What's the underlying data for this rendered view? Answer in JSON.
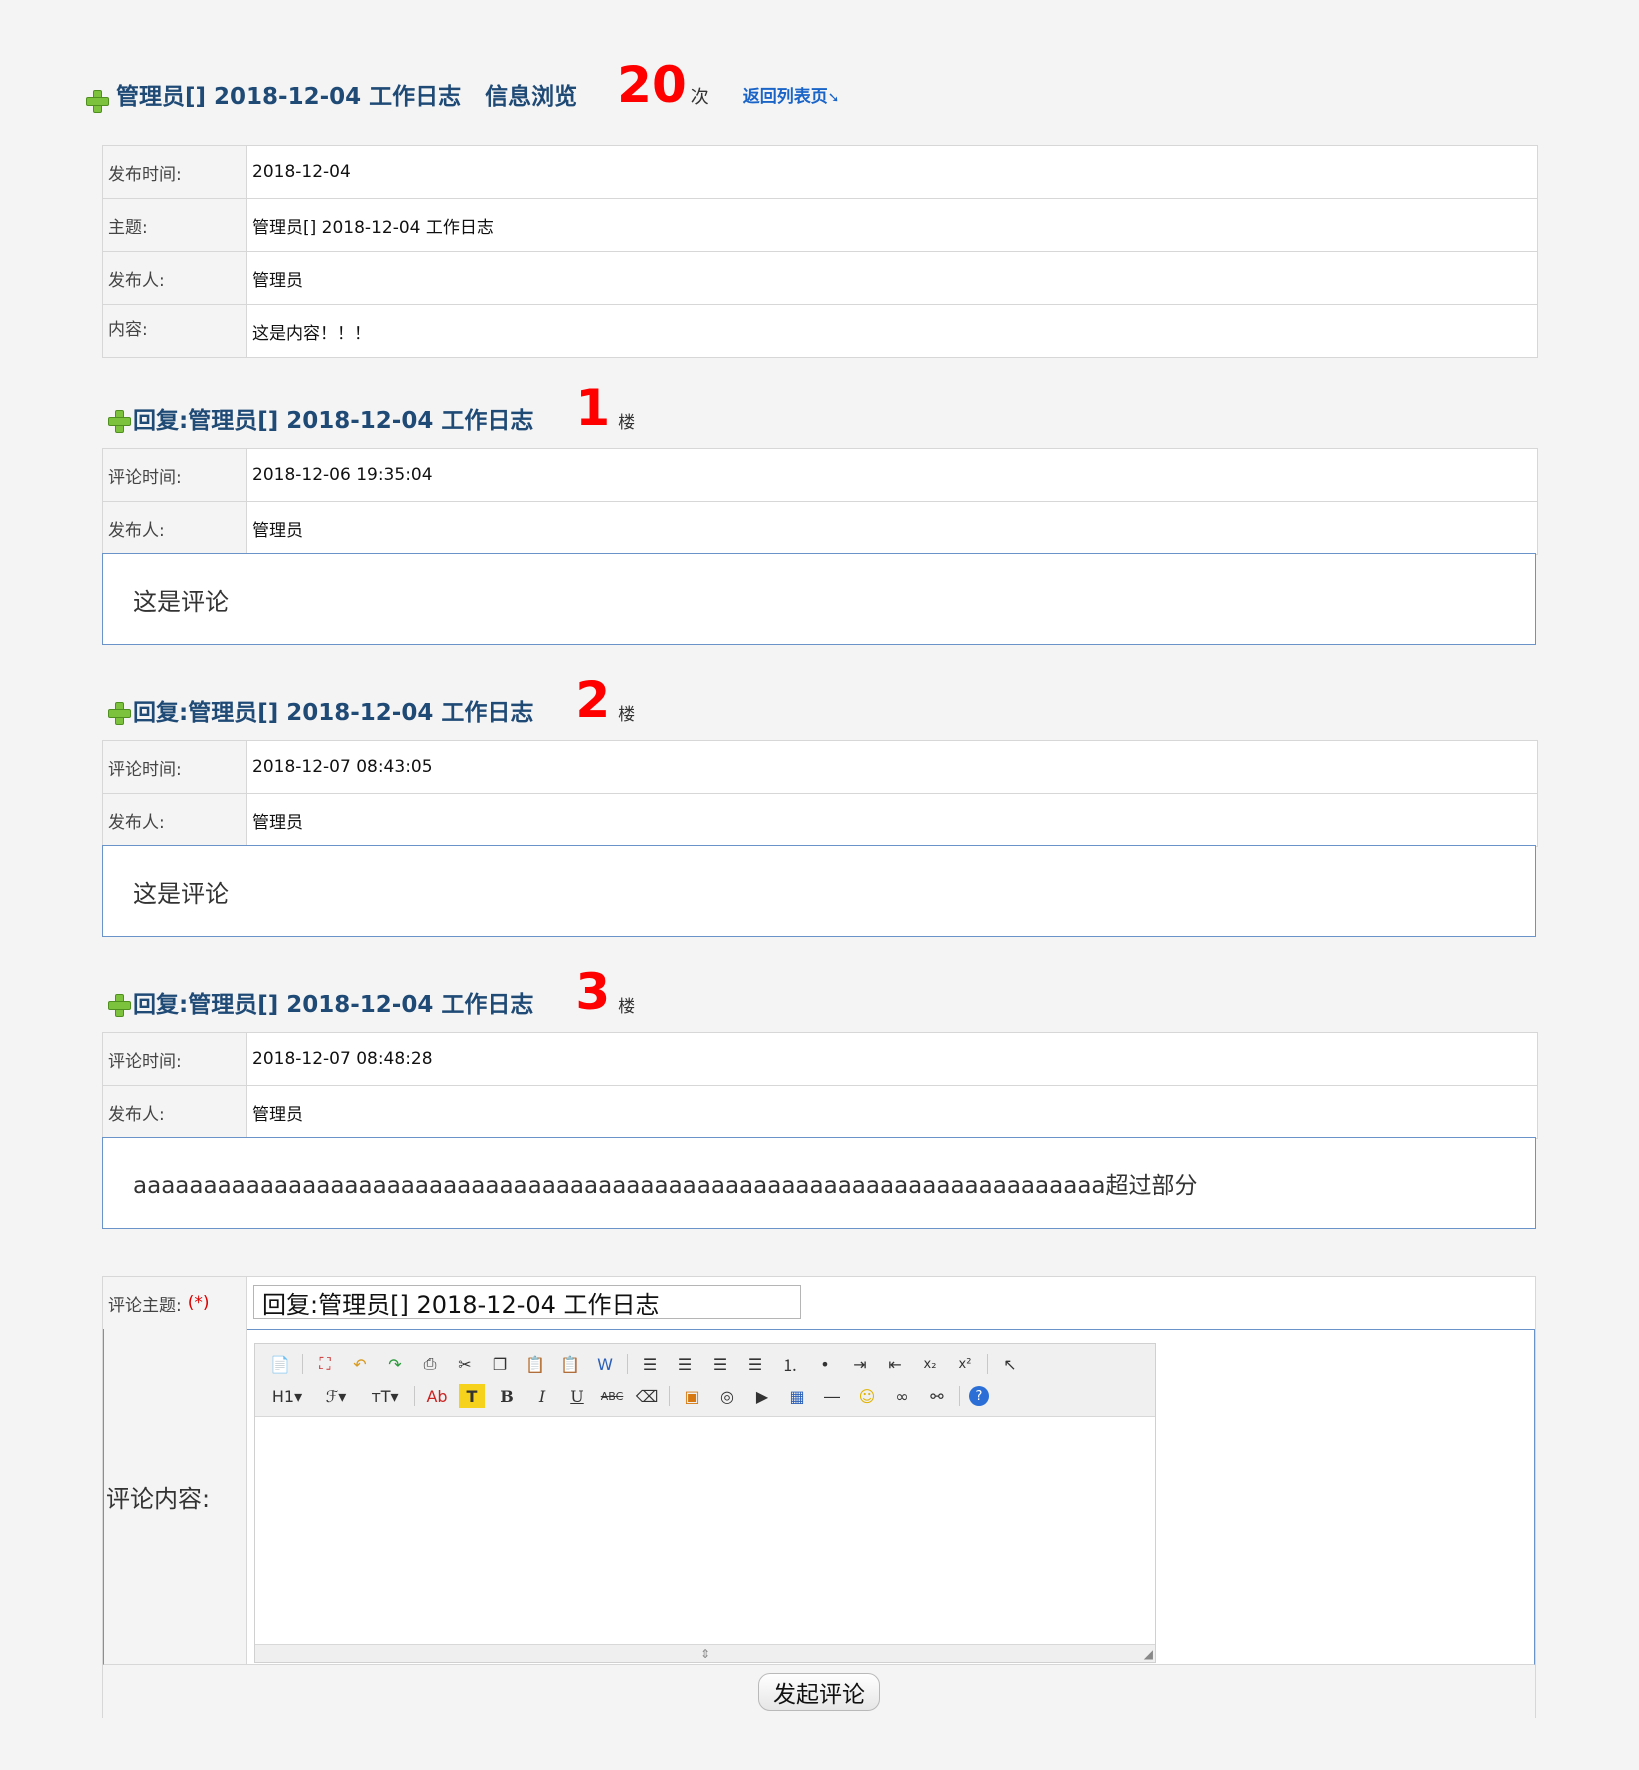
{
  "header": {
    "title": "管理员[] 2018-12-04 工作日志",
    "subtitle": "信息浏览",
    "view_count": "20",
    "view_unit": "次",
    "back_link": "返回列表页",
    "back_icon": "arrow-down-right-icon"
  },
  "post": {
    "rows": [
      {
        "label": "发布时间:",
        "value": "2018-12-04"
      },
      {
        "label": "主题:",
        "value": "管理员[] 2018-12-04 工作日志"
      },
      {
        "label": "发布人:",
        "value": "管理员"
      },
      {
        "label": "内容:",
        "value": "这是内容！！！"
      }
    ]
  },
  "replies": [
    {
      "title": "回复:管理员[] 2018-12-04 工作日志",
      "floor": "1",
      "floor_unit": "楼",
      "time_label": "评论时间:",
      "time": "2018-12-06 19:35:04",
      "author_label": "发布人:",
      "author": "管理员",
      "content": "这是评论"
    },
    {
      "title": "回复:管理员[] 2018-12-04 工作日志",
      "floor": "2",
      "floor_unit": "楼",
      "time_label": "评论时间:",
      "time": "2018-12-07 08:43:05",
      "author_label": "发布人:",
      "author": "管理员",
      "content": "这是评论"
    },
    {
      "title": "回复:管理员[] 2018-12-04 工作日志",
      "floor": "3",
      "floor_unit": "楼",
      "time_label": "评论时间:",
      "time": "2018-12-07 08:48:28",
      "author_label": "发布人:",
      "author": "管理员",
      "content": "aaaaaaaaaaaaaaaaaaaaaaaaaaaaaaaaaaaaaaaaaaaaaaaaaaaaaaaaaaaaaaaaaaaaa超过部分"
    }
  ],
  "form": {
    "subject_label": "评论主题:",
    "required_mark": "(*)",
    "subject_value": "回复:管理员[] 2018-12-04 工作日志",
    "content_label": "评论内容:",
    "submit_label": "发起评论"
  },
  "toolbar": {
    "row1": [
      "source-icon",
      "fullscreen-icon",
      "undo-icon",
      "redo-icon",
      "print-icon",
      "cut-icon",
      "copy-icon",
      "paste-icon",
      "paste-text-icon",
      "paste-word-icon",
      "align-left-icon",
      "align-center-icon",
      "align-right-icon",
      "justify-icon",
      "ordered-list-icon",
      "unordered-list-icon",
      "indent-icon",
      "outdent-icon",
      "subscript-icon",
      "superscript-icon",
      "select-all-icon"
    ],
    "row2": [
      "heading-icon",
      "font-family-icon",
      "font-size-icon",
      "font-color-icon",
      "highlight-icon",
      "bold-icon",
      "italic-icon",
      "underline-icon",
      "strikethrough-icon",
      "remove-format-icon",
      "image-icon",
      "flash-icon",
      "media-icon",
      "table-icon",
      "hr-icon",
      "emoticon-icon",
      "link-icon",
      "unlink-icon",
      "help-icon"
    ]
  }
}
